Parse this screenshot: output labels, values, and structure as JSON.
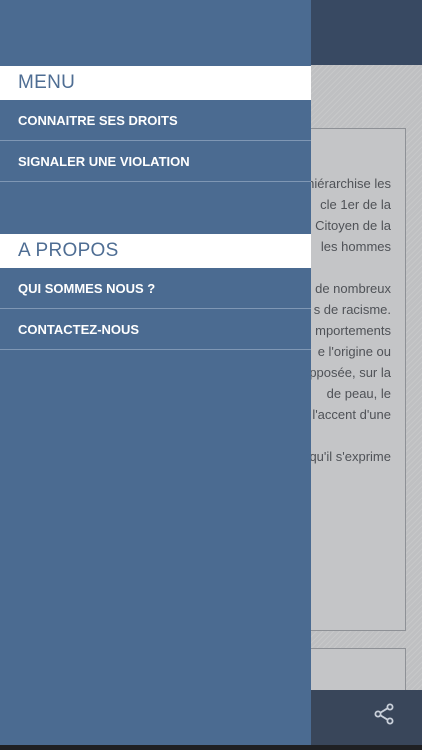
{
  "drawer": {
    "sections": [
      {
        "title": "MENU",
        "items": [
          "CONNAITRE SES DROITS",
          "SIGNALER UNE VIOLATION"
        ]
      },
      {
        "title": "A PROPOS",
        "items": [
          "QUI SOMMES NOUS ?",
          "CONTACTEZ-NOUS"
        ]
      }
    ]
  },
  "background": {
    "lines": [
      "hiérarchise les",
      "cle 1er de la",
      "Citoyen de la",
      "les hommes",
      "",
      "de nombreux",
      "s de racisme.",
      "mportements",
      "e l'origine ou",
      "pposée, sur la",
      "de peau, le",
      "l'accent d'une",
      "",
      "qu'il s'exprime"
    ]
  },
  "icons": {
    "share": "share-icon"
  },
  "colors": {
    "drawer": "#4b6b91",
    "section_title": "#4e6d93",
    "header": "#384962"
  }
}
